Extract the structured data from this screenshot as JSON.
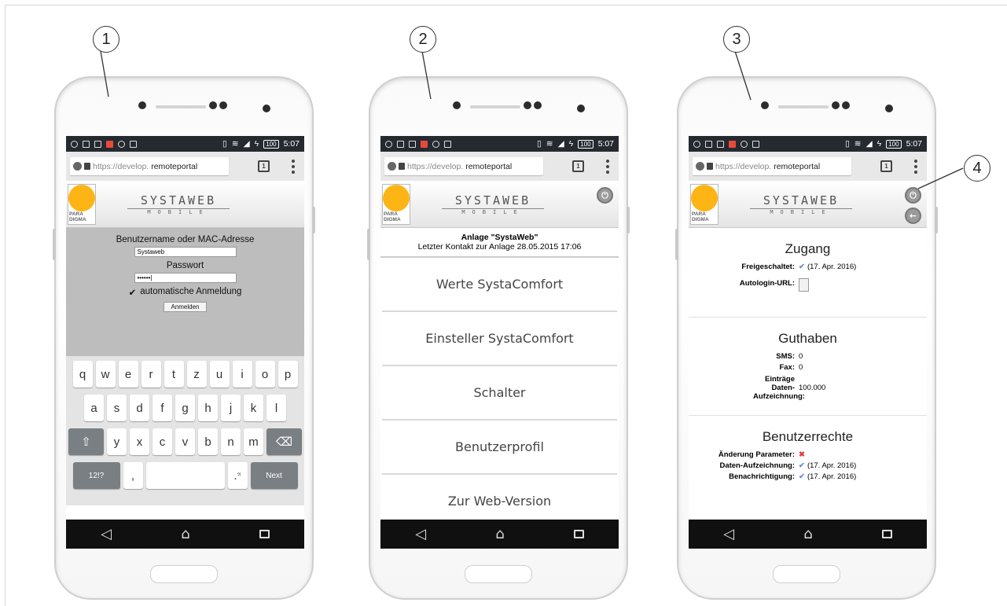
{
  "callouts": [
    "1",
    "2",
    "3",
    "4"
  ],
  "colors": {
    "status_bar": "#252a30",
    "login_bg": "#bdbdbd",
    "logo_sun": "#fdb515",
    "check_blue": "#6b8fc2",
    "cross_red": "#e04040"
  },
  "status_bar": {
    "battery": "100",
    "time": "5:07"
  },
  "browser": {
    "url_prefix": "https://develop.",
    "url_domain": "remoteportal",
    "tab_count": "1"
  },
  "logo": {
    "line1": "PARA",
    "line2": "DIGMA",
    "brand_big": "SYSTAWEB",
    "brand_small": "MOBILE"
  },
  "login": {
    "username_label": "Benutzername oder MAC-Adresse",
    "username_value": "Systaweb",
    "password_label": "Passwort",
    "password_value": "••••••|",
    "auto_login_label": "automatische Anmeldung",
    "submit_label": "Anmelden"
  },
  "keyboard": {
    "row1": [
      "q",
      "w",
      "e",
      "r",
      "t",
      "z",
      "u",
      "i",
      "o",
      "p"
    ],
    "row2": [
      "a",
      "s",
      "d",
      "f",
      "g",
      "h",
      "j",
      "k",
      "l"
    ],
    "row3": [
      "y",
      "x",
      "c",
      "v",
      "b",
      "n",
      "m"
    ],
    "shift_icon": "shift-icon",
    "backspace_icon": "backspace-icon",
    "num_label": "12!?",
    "comma": ",",
    "period": ".",
    "period_hint": "?!",
    "next_label": "Next"
  },
  "menu_screen": {
    "anlage_title": "Anlage \"SystaWeb\"",
    "last_contact": "Letzter Kontakt zur Anlage 28.05.2015 17:06",
    "items": [
      "Werte SystaComfort",
      "Einsteller SystaComfort",
      "Schalter",
      "Benutzerprofil",
      "Zur Web-Version"
    ]
  },
  "profile_screen": {
    "zugang": {
      "title": "Zugang",
      "freigeschaltet_label": "Freigeschaltet:",
      "freigeschaltet_value": "(17. Apr. 2016)",
      "autologin_label": "Autologin-URL:"
    },
    "guthaben": {
      "title": "Guthaben",
      "sms_label": "SMS:",
      "sms_value": "0",
      "fax_label": "Fax:",
      "fax_value": "0",
      "eintraege_label": "Einträge Daten-Aufzeichnung:",
      "eintraege_value": "100.000"
    },
    "benutzerrechte": {
      "title": "Benutzerrechte",
      "aenderung_label": "Änderung Parameter:",
      "daten_label": "Daten-Aufzeichnung:",
      "daten_value": "(17. Apr. 2016)",
      "benach_label": "Benachrichtigung:",
      "benach_value": "(17. Apr. 2016)"
    }
  }
}
